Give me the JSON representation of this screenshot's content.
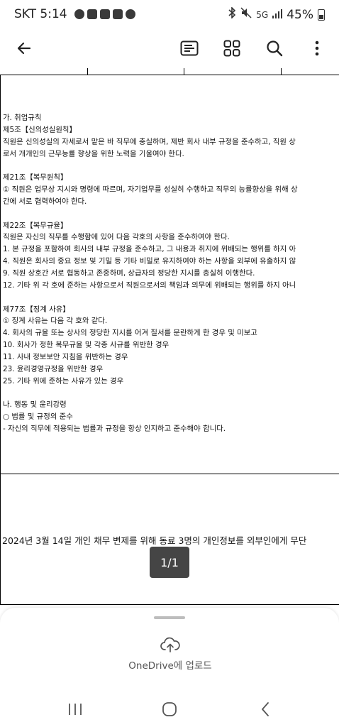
{
  "status_bar": {
    "carrier_time": "SKT 5:14",
    "network": "5G",
    "battery": "45%"
  },
  "app_bar": {
    "back_icon": "arrow-left-icon",
    "icons": [
      "text-view-icon",
      "grid-view-icon",
      "search-icon",
      "more-vert-icon"
    ]
  },
  "document": {
    "lines": [
      "가. 취업규칙",
      "제5조【신의성실원칙】",
      "직원은 신의성실의 자세로서 맡은 바 직무에 충실하며, 제반 회사 내부 규정을 준수하고, 직원 상",
      "로서 개개인의 근무능률 향상을 위한 노력을 기울여야 한다.",
      "",
      "제21조【복무원칙】",
      "① 직원은 업무상 지시와 명령에 따르며, 자기업무를 성실히 수행하고 직무의 능률향상을 위해 상",
      "간에 서로 협력하여야 한다.",
      "",
      "제22조【복무규율】",
      "직원은 자신의 직무를 수행함에 있어 다음 각호의 사항을 준수하여야 한다.",
      "1. 본 규정을 포함하여 회사의 내부 규정을 준수하고, 그 내용과 취지에 위배되는 행위를 하지 아",
      "4. 직원은 회사의 중요 정보 및 기밀 등 기타 비밀로 유지하여야 하는 사항을 외부에 유출하지 않",
      "9. 직원 상호간 서로 협동하고 존중하며, 상급자의 정당한 지시를 충실히 이행한다.",
      "12. 기타 위 각 호에 준하는 사항으로서 직원으로서의 책임과 의무에 위배되는 행위를 하지 아니",
      "",
      "제77조【징계 사유】",
      "① 징계 사유는 다음 각 호와 같다.",
      "4. 회사의 규율 또는 상사의 정당한 지시를 어겨 질서를 문란하게 한 경우 및 미보고",
      "10. 회사가 정한 복무규율 및 각종 사규를 위반한 경우",
      "11. 사내 정보보안 지침을 위반하는 경우",
      "23. 윤리경영규정을 위반한 경우",
      "25. 기타 위에 준하는 사유가 있는 경우",
      "",
      "나. 행동 및 윤리강령",
      "○ 법률 및 규정의 준수",
      "- 자신의 직무에 적용되는 법률과 규정을 항상 인지하고 준수해야 합니다."
    ],
    "incident": "2024년 3월 14일 개인 채무 변제를 위해 동료 3명의 개인정보를 외부인에게 무단",
    "page_indicator": "1/1"
  },
  "bottom_sheet": {
    "upload_label": "OneDrive에 업로드",
    "upload_icon": "cloud-upload-icon"
  },
  "nav_bar": {
    "icons": [
      "recent-apps-icon",
      "home-icon",
      "back-icon"
    ]
  }
}
